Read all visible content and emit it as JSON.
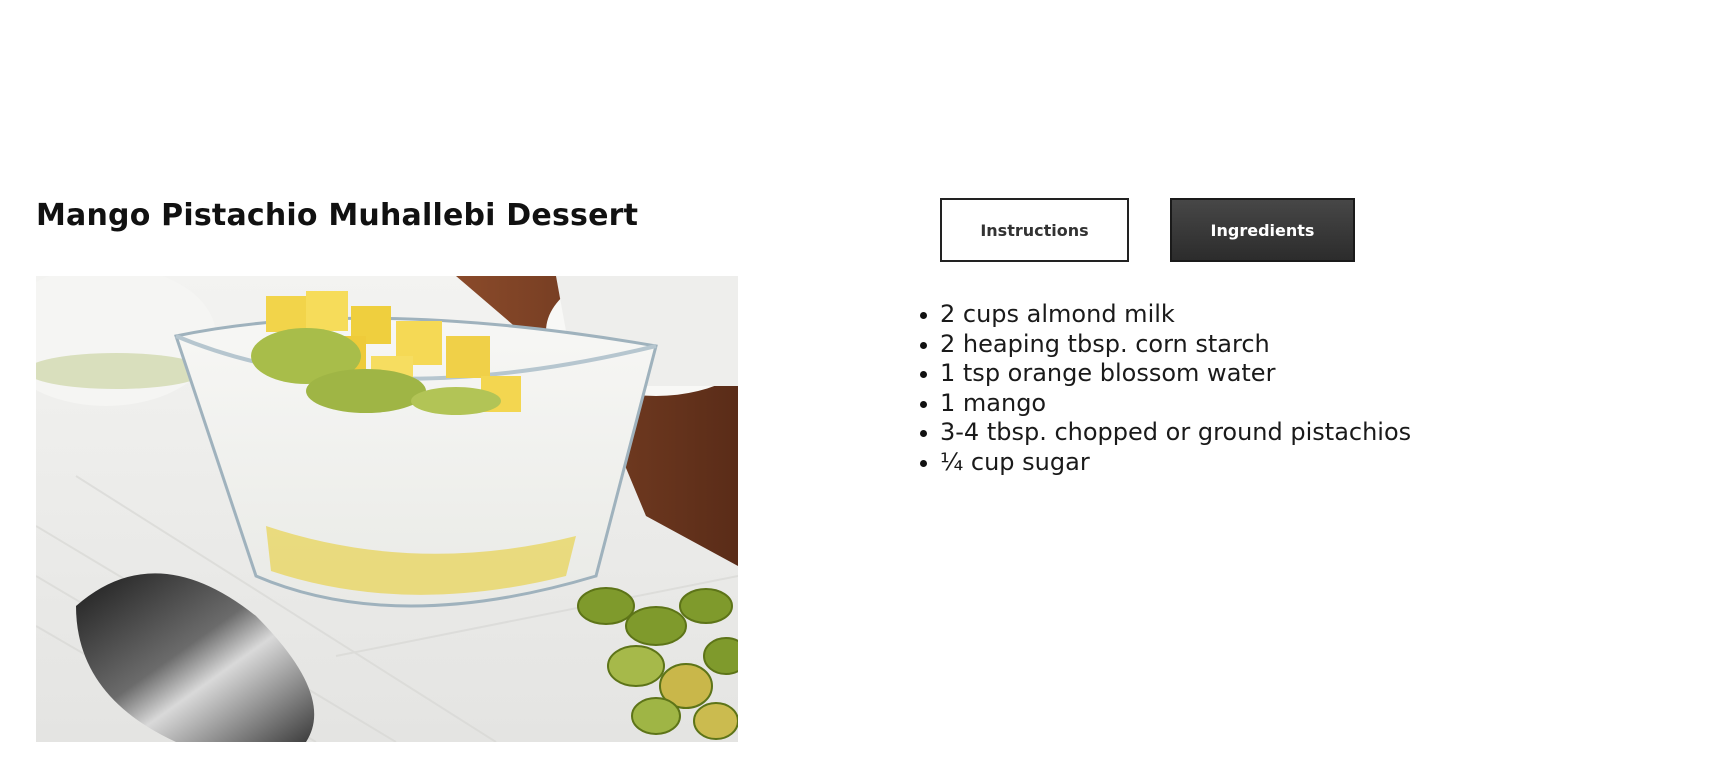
{
  "recipe": {
    "title": "Mango Pistachio Muhallebi Dessert"
  },
  "tabs": [
    {
      "label": "Instructions",
      "active": false
    },
    {
      "label": "Ingredients",
      "active": true
    }
  ],
  "ingredients": [
    "2 cups almond milk",
    "2 heaping tbsp. corn starch",
    "1 tsp orange blossom water",
    "1 mango",
    "3-4 tbsp. chopped or ground pistachios",
    "¼ cup sugar"
  ],
  "colors": {
    "active_tab_bg": "#3a3a3a",
    "inactive_tab_border": "#222222",
    "text": "#111111"
  }
}
